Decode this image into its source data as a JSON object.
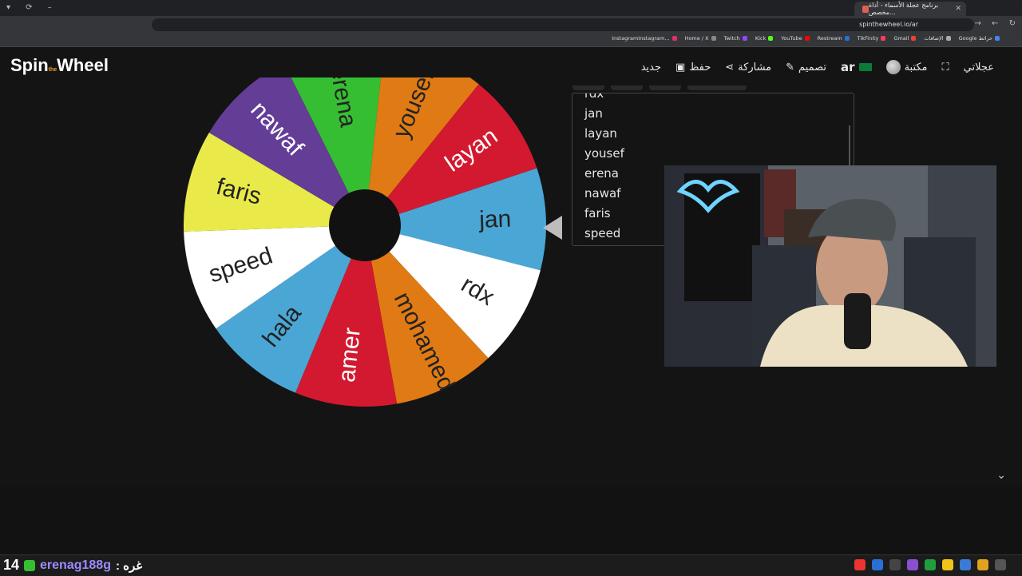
{
  "browser": {
    "tab_title": "برنامج عجلة الأسماء - أداة مخصص...",
    "address": "spinthewheel.io/ar",
    "bookmarks": [
      "InstagramInstagram...",
      "Home / X",
      "Twitch",
      "Kick",
      "YouTube",
      "Restream",
      "TikFinity",
      "Gmail",
      "الإضافات",
      "Google خرائط"
    ]
  },
  "app": {
    "logo_prefix": "Spin",
    "logo_small": "the",
    "logo_suffix": "Wheel",
    "menu": {
      "new": "جديد",
      "save": "حفظ",
      "share": "مشاركة",
      "design": "تصميم",
      "lang": "ar",
      "library": "مكتبة",
      "my_wheel": "عجلاتي"
    }
  },
  "wheel": {
    "segments": [
      {
        "name": "jan",
        "color": "#4aa6d5",
        "text_color": "#222222"
      },
      {
        "name": "rdx",
        "color": "#ffffff",
        "text_color": "#222222"
      },
      {
        "name": "mohamed",
        "color": "#e07a14",
        "text_color": "#222222"
      },
      {
        "name": "amer",
        "color": "#d2192f",
        "text_color": "#ffffff"
      },
      {
        "name": "hala",
        "color": "#4aa6d5",
        "text_color": "#222222"
      },
      {
        "name": "speed",
        "color": "#ffffff",
        "text_color": "#222222"
      },
      {
        "name": "faris",
        "color": "#e9ea4a",
        "text_color": "#222222"
      },
      {
        "name": "nawaf",
        "color": "#643d97",
        "text_color": "#ffffff"
      },
      {
        "name": "erena",
        "color": "#36be32",
        "text_color": "#222222"
      },
      {
        "name": "yousef",
        "color": "#e07a14",
        "text_color": "#222222"
      },
      {
        "name": "layan",
        "color": "#d2192f",
        "text_color": "#ffffff"
      }
    ],
    "center_color": "#111111"
  },
  "entries": [
    "rdx",
    "jan",
    "layan",
    "yousef",
    "erena",
    "nawaf",
    "faris",
    "speed"
  ],
  "chat": {
    "count": "14",
    "username": "erenag188g",
    "message": ": غره"
  }
}
